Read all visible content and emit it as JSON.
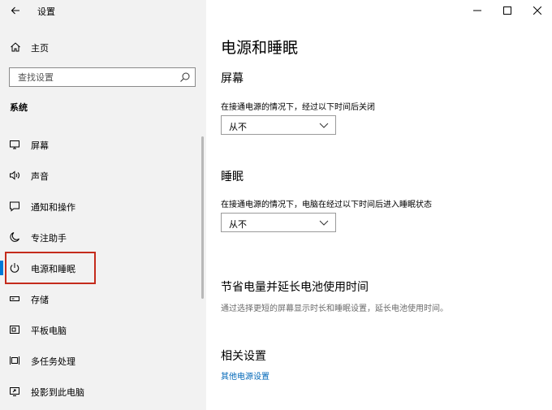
{
  "window": {
    "title": "设置"
  },
  "sidebar": {
    "home_label": "主页",
    "search_placeholder": "查找设置",
    "section_label": "系统",
    "items": [
      {
        "label": "屏幕",
        "icon": "monitor-icon"
      },
      {
        "label": "声音",
        "icon": "speaker-icon"
      },
      {
        "label": "通知和操作",
        "icon": "notification-icon"
      },
      {
        "label": "专注助手",
        "icon": "moon-icon"
      },
      {
        "label": "电源和睡眠",
        "icon": "power-icon",
        "active": true
      },
      {
        "label": "存储",
        "icon": "storage-icon"
      },
      {
        "label": "平板电脑",
        "icon": "tablet-icon"
      },
      {
        "label": "多任务处理",
        "icon": "multitask-icon"
      },
      {
        "label": "投影到此电脑",
        "icon": "project-icon"
      }
    ]
  },
  "main": {
    "title": "电源和睡眠",
    "screen": {
      "heading": "屏幕",
      "description": "在接通电源的情况下，经过以下时间后关闭",
      "value": "从不"
    },
    "sleep": {
      "heading": "睡眠",
      "description": "在接通电源的情况下，电脑在经过以下时间后进入睡眠状态",
      "value": "从不"
    },
    "battery": {
      "heading": "节省电量并延长电池使用时间",
      "description": "通过选择更短的屏幕显示时长和睡眠设置，延长电池使用时间。"
    },
    "related": {
      "heading": "相关设置",
      "link": "其他电源设置"
    }
  },
  "colors": {
    "accent": "#0078d7",
    "link": "#0067b8",
    "highlight": "#c42b1c",
    "sidebar_bg": "#f2f2f2"
  }
}
